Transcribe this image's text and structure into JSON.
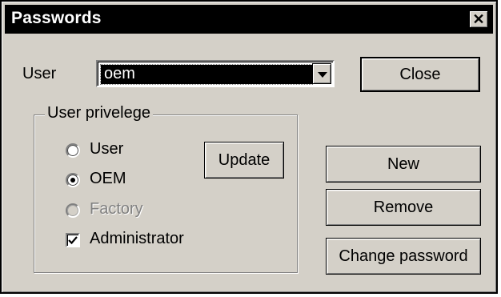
{
  "window": {
    "title": "Passwords",
    "close_glyph": "✕"
  },
  "user_row": {
    "label": "User",
    "selected_value": "oem"
  },
  "buttons": {
    "close": "Close",
    "update": "Update",
    "new": "New",
    "remove": "Remove",
    "change_password": "Change password"
  },
  "privilege_group": {
    "title": "User privelege",
    "options": [
      {
        "label": "User",
        "selected": false,
        "enabled": true
      },
      {
        "label": "OEM",
        "selected": true,
        "enabled": true
      },
      {
        "label": "Factory",
        "selected": false,
        "enabled": false
      }
    ],
    "administrator": {
      "label": "Administrator",
      "checked": true
    }
  },
  "colors": {
    "face": "#d4d0c8",
    "titlebar": "#000000",
    "selection": "#000000",
    "disabled_text": "#808080"
  },
  "icons": {
    "close": "close-icon",
    "dropdown": "chevron-down-icon",
    "check": "checkmark-icon"
  }
}
